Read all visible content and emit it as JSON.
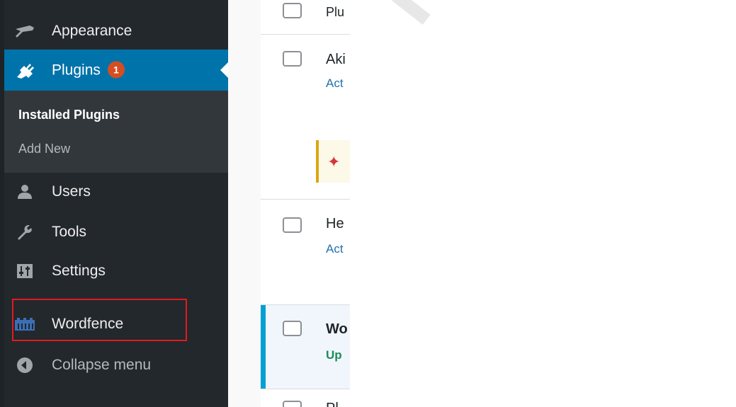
{
  "sidebar": {
    "appearance": "Appearance",
    "plugins": "Plugins",
    "plugins_badge": "1",
    "submenu": {
      "installed": "Installed Plugins",
      "add_new": "Add New"
    },
    "users": "Users",
    "tools": "Tools",
    "settings": "Settings",
    "wordfence": "Wordfence",
    "collapse": "Collapse menu"
  },
  "plugin_list": {
    "header": "Plu",
    "rows": [
      {
        "title": "Aki",
        "link": "Act"
      },
      {
        "title": "He",
        "link": "Act"
      },
      {
        "title": "Wo",
        "link": "Up"
      },
      {
        "title": "Pl",
        "link": ""
      }
    ]
  },
  "watermark": "Present Respo",
  "colors": {
    "sidebar_bg": "#23282d",
    "active_blue": "#0073aa",
    "badge_orange": "#d54e21",
    "highlight_red": "#e21b1b",
    "link_blue": "#2271b1",
    "update_green": "#1e8b5a"
  }
}
